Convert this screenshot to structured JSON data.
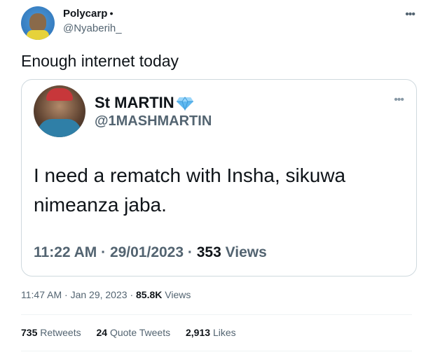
{
  "tweet": {
    "author": {
      "name": "Polycarp",
      "badge_icon": "apple-icon",
      "handle": "@Nyaberih_"
    },
    "text": "Enough internet today",
    "time": "11:47 AM",
    "date": "Jan 29, 2023",
    "views_count": "85.8K",
    "views_label": "Views"
  },
  "quote": {
    "author": {
      "name": "St MARTIN",
      "badge_icon": "diamond-icon",
      "handle": "@1MASHMARTIN"
    },
    "text": "I need a rematch with Insha, sikuwa nimeanza jaba.",
    "time": "11:22 AM",
    "date": "29/01/2023",
    "views_count": "353",
    "views_label": "Views"
  },
  "stats": {
    "retweets": {
      "count": "735",
      "label": "Retweets"
    },
    "quote_tweets": {
      "count": "24",
      "label": "Quote Tweets"
    },
    "likes": {
      "count": "2,913",
      "label": "Likes"
    }
  },
  "colors": {
    "text": "#0f1419",
    "secondary": "#536471",
    "border": "#cfd9de",
    "diamond": "#5fb8f0"
  }
}
